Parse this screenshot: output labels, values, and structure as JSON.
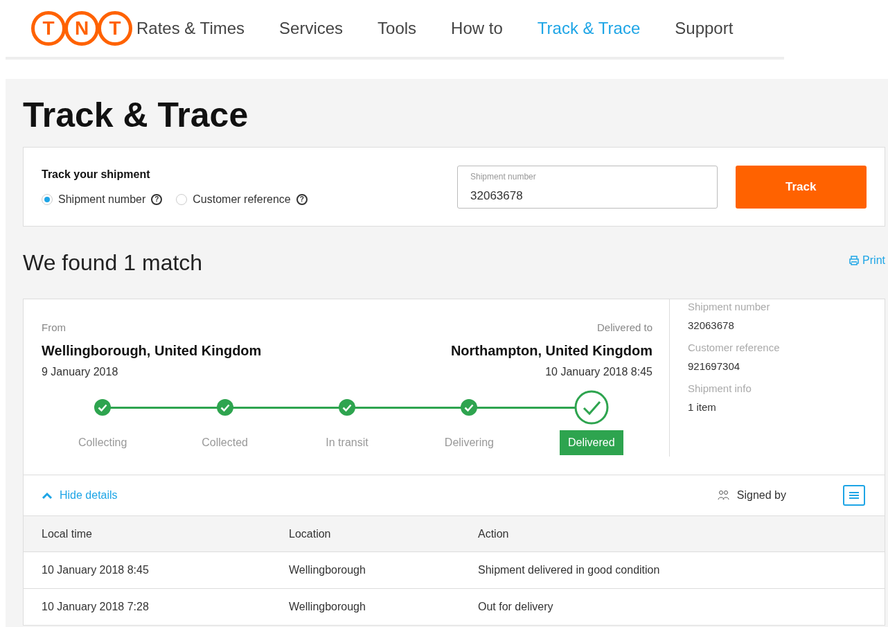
{
  "logo": {
    "letters": [
      "T",
      "N",
      "T"
    ]
  },
  "nav": [
    {
      "label": "Rates & Times",
      "selected": false
    },
    {
      "label": "Services",
      "selected": false
    },
    {
      "label": "Tools",
      "selected": false
    },
    {
      "label": "How to",
      "selected": false
    },
    {
      "label": "Track & Trace",
      "selected": true
    },
    {
      "label": "Support",
      "selected": false
    }
  ],
  "page_title": "Track & Trace",
  "search": {
    "heading": "Track your shipment",
    "options": [
      {
        "label": "Shipment number",
        "selected": true
      },
      {
        "label": "Customer reference",
        "selected": false
      }
    ],
    "help": "?",
    "field_label": "Shipment number",
    "value": "32063678",
    "button": "Track"
  },
  "results_title": "We found 1 match",
  "print": "Print",
  "shipment": {
    "from_label": "From",
    "from": "Wellingborough, United Kingdom",
    "from_date": "9 January 2018",
    "to_label": "Delivered to",
    "to": "Northampton, United Kingdom",
    "to_date": "10 January 2018 8:45",
    "steps": [
      {
        "label": "Collecting",
        "done": true,
        "current": false
      },
      {
        "label": "Collected",
        "done": true,
        "current": false
      },
      {
        "label": "In transit",
        "done": true,
        "current": false
      },
      {
        "label": "Delivering",
        "done": true,
        "current": false
      },
      {
        "label": "Delivered",
        "done": true,
        "current": true
      }
    ],
    "info": [
      {
        "label": "Shipment number",
        "value": "32063678"
      },
      {
        "label": "Customer reference",
        "value": "921697304"
      },
      {
        "label": "Shipment info",
        "value": "1 item"
      }
    ],
    "hide_details": "Hide details",
    "signed_by": "Signed by"
  },
  "table": {
    "columns": [
      "Local time",
      "Location",
      "Action"
    ],
    "rows": [
      [
        "10 January 2018 8:45",
        "Wellingborough",
        "Shipment delivered in good condition"
      ],
      [
        "10 January 2018 7:28",
        "Wellingborough",
        "Out for delivery"
      ]
    ]
  }
}
